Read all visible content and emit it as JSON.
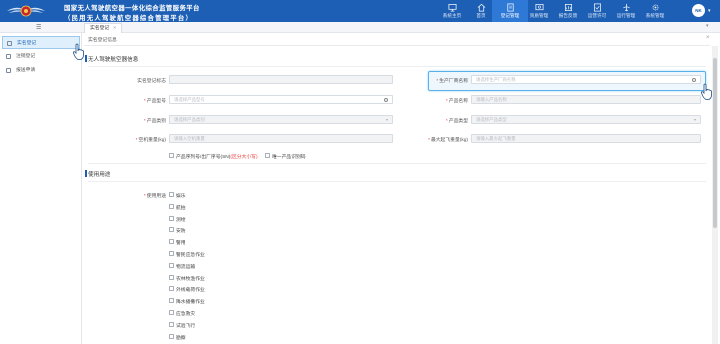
{
  "header": {
    "title_line1": "国家无人驾驶航空器一体化综合监管服务平台",
    "title_line2": "（民用无人驾驶航空器综合管理平台）",
    "nav": [
      {
        "label": "系统主页",
        "icon": "monitor-icon",
        "active": false
      },
      {
        "label": "首页",
        "icon": "home-icon",
        "active": false
      },
      {
        "label": "登记管理",
        "icon": "document-icon",
        "active": true
      },
      {
        "label": "资质管理",
        "icon": "certificate-icon",
        "active": false
      },
      {
        "label": "报告反馈",
        "icon": "report-icon",
        "active": false
      },
      {
        "label": "运营许可",
        "icon": "permit-icon",
        "active": false
      },
      {
        "label": "运行管理",
        "icon": "plane-icon",
        "active": false
      },
      {
        "label": "系统管理",
        "icon": "gear-icon",
        "active": false
      }
    ],
    "avatar_text": "NK"
  },
  "tabbar": {
    "menu_icon": "☰",
    "tab_label": "实名登记",
    "tab_close": "×"
  },
  "sidebar": {
    "items": [
      {
        "label": "实名登记",
        "active": true
      },
      {
        "label": "注销登记",
        "active": false
      },
      {
        "label": "报送申请",
        "active": false
      }
    ]
  },
  "main": {
    "breadcrumb": "实名登记信息",
    "close": "×",
    "section1_title": "无人驾驶航空器信息",
    "fields": {
      "reg_no_label": "实名登记标志",
      "maker_label": "生产厂商名称",
      "maker_placeholder": "请选择生产厂商名称",
      "model_label": "产品型号",
      "model_placeholder": "请选择产品型号",
      "name_label": "产品名称",
      "name_placeholder": "请输入产品名称",
      "category_label": "产品类别",
      "category_placeholder": "请选择产品类别",
      "type_label": "产品类型",
      "type_placeholder": "请选择产品类型",
      "empty_weight_label": "空机重量(kg)",
      "empty_weight_placeholder": "请输入空机重量",
      "mtow_label": "最大起飞重量(kg)",
      "mtow_placeholder": "请输入最大起飞重量"
    },
    "serial_option_label": "产品序列号/出厂序号(SN)",
    "serial_option_note": "(区分大小写)",
    "unique_code_label": "唯一产品识别码",
    "section2_title": "使用用途",
    "usage_label": "使用用途",
    "usages": [
      "娱乐",
      "航拍",
      "测绘",
      "安防",
      "警用",
      "警民应急作业",
      "物流运输",
      "农林牧渔作业",
      "外线载荷作业",
      "降水播撒作业",
      "应急救灾",
      "试验飞行",
      "勘察"
    ]
  }
}
